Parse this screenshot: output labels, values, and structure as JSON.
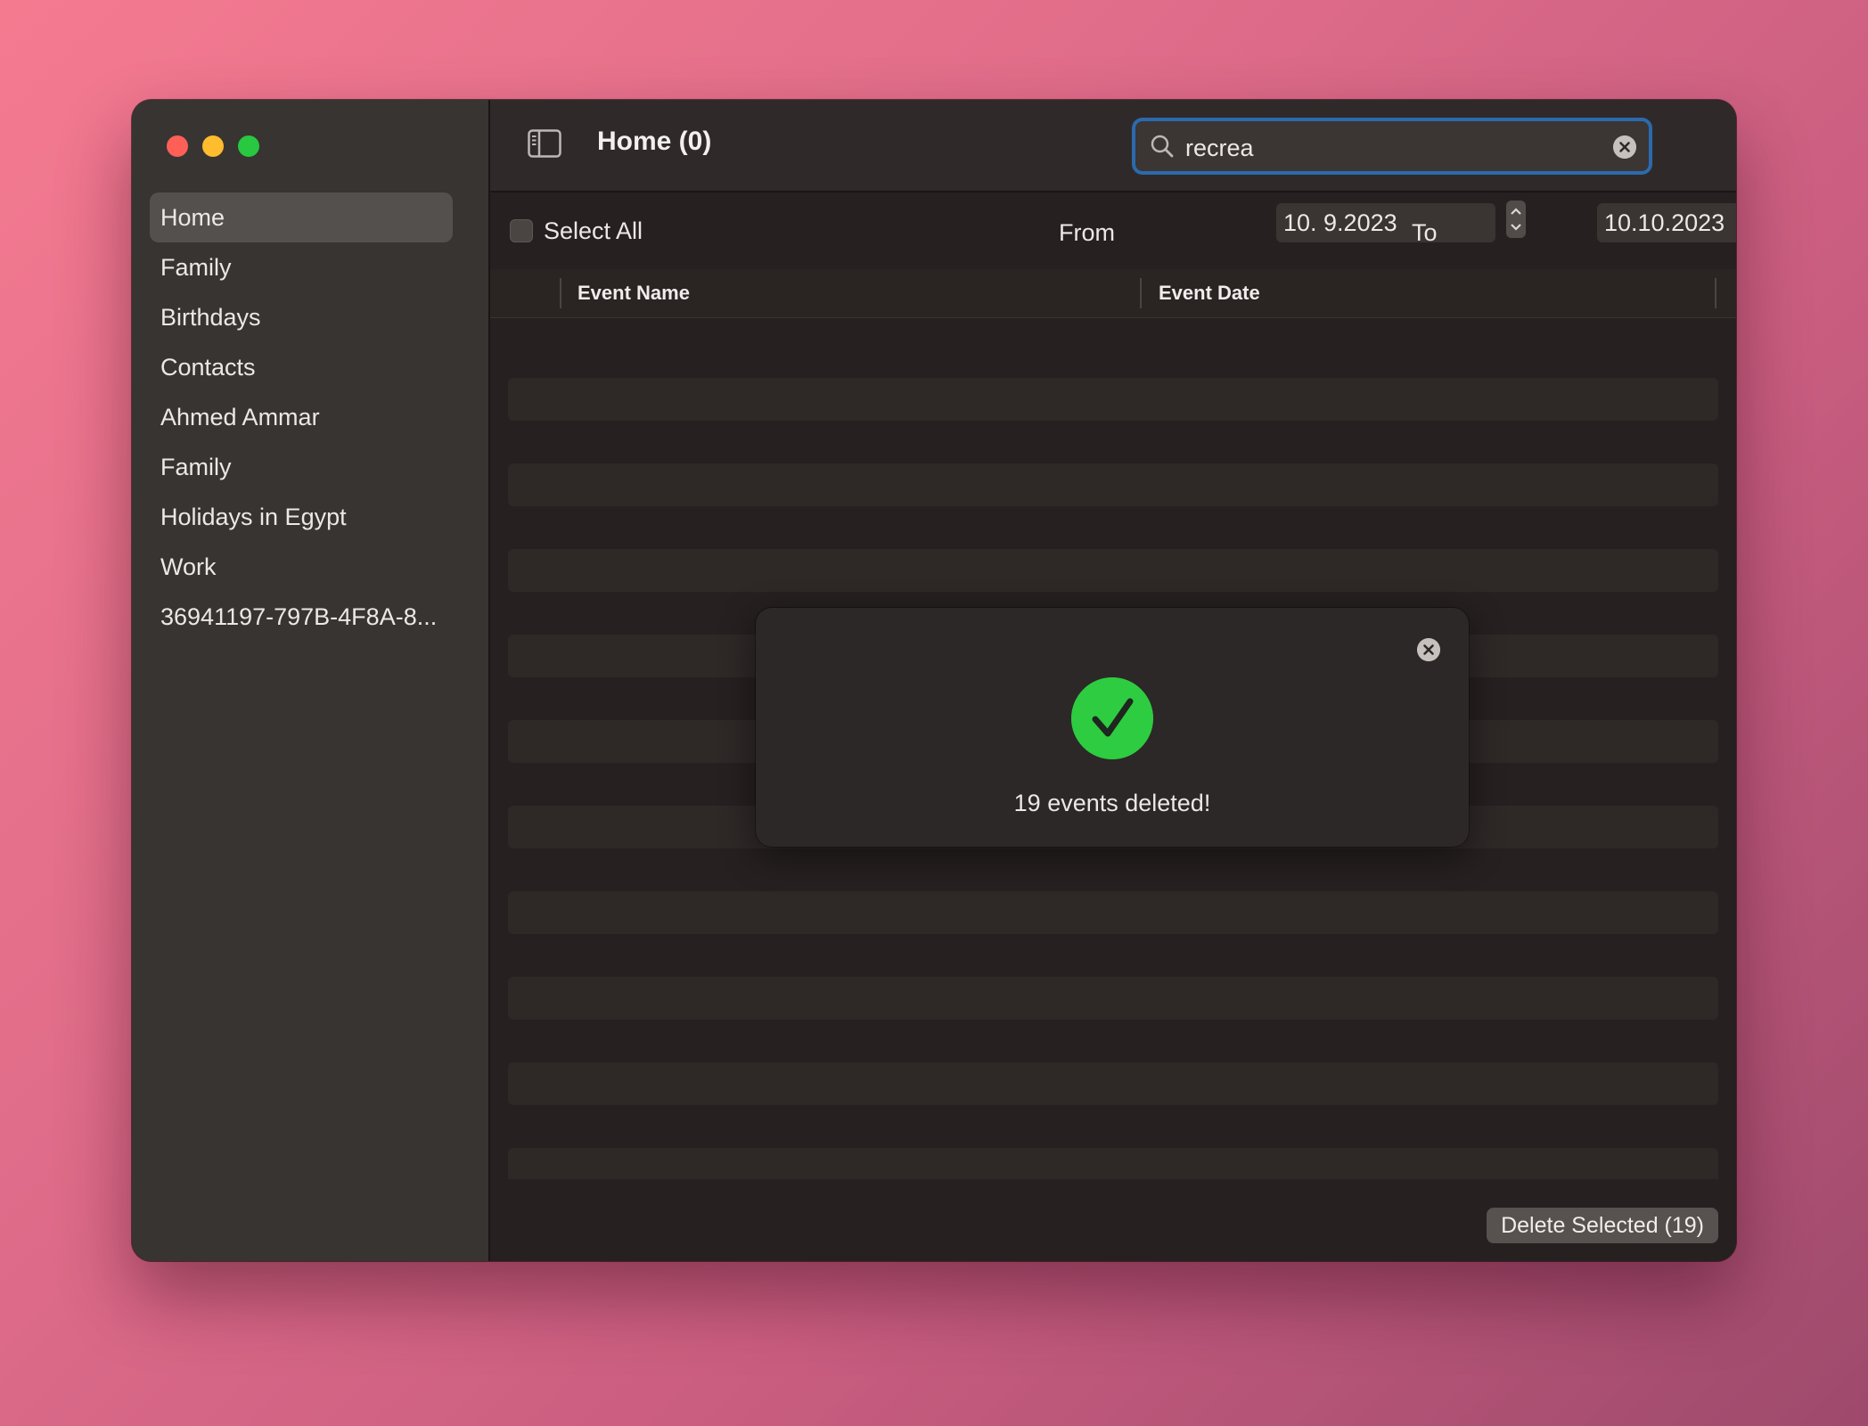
{
  "window": {
    "title": "Home (0)"
  },
  "sidebar": {
    "items": [
      {
        "label": "Home",
        "selected": true
      },
      {
        "label": "Family"
      },
      {
        "label": "Birthdays"
      },
      {
        "label": "Contacts"
      },
      {
        "label": "Ahmed Ammar"
      },
      {
        "label": "Family"
      },
      {
        "label": "Holidays in Egypt"
      },
      {
        "label": "Work"
      },
      {
        "label": "36941197-797B-4F8A-8..."
      }
    ]
  },
  "search": {
    "value": "recrea",
    "icon": "search-icon",
    "clear_icon": "clear-icon"
  },
  "filters": {
    "select_all_label": "Select All",
    "select_all_checked": false,
    "from_label": "From",
    "from_value": "10.  9.2023",
    "to_label": "To",
    "to_value": "10.10.2023"
  },
  "table": {
    "columns": [
      "Event Name",
      "Event Date"
    ],
    "rows": []
  },
  "footer": {
    "delete_label": "Delete Selected (19)"
  },
  "toast": {
    "message": "19 events deleted!",
    "icon": "checkmark-icon"
  },
  "colors": {
    "accent_focus": "#2b6aad",
    "success": "#2ecc40",
    "close": "#fe5f57",
    "minimize": "#febc2e",
    "maximize": "#28c840"
  }
}
